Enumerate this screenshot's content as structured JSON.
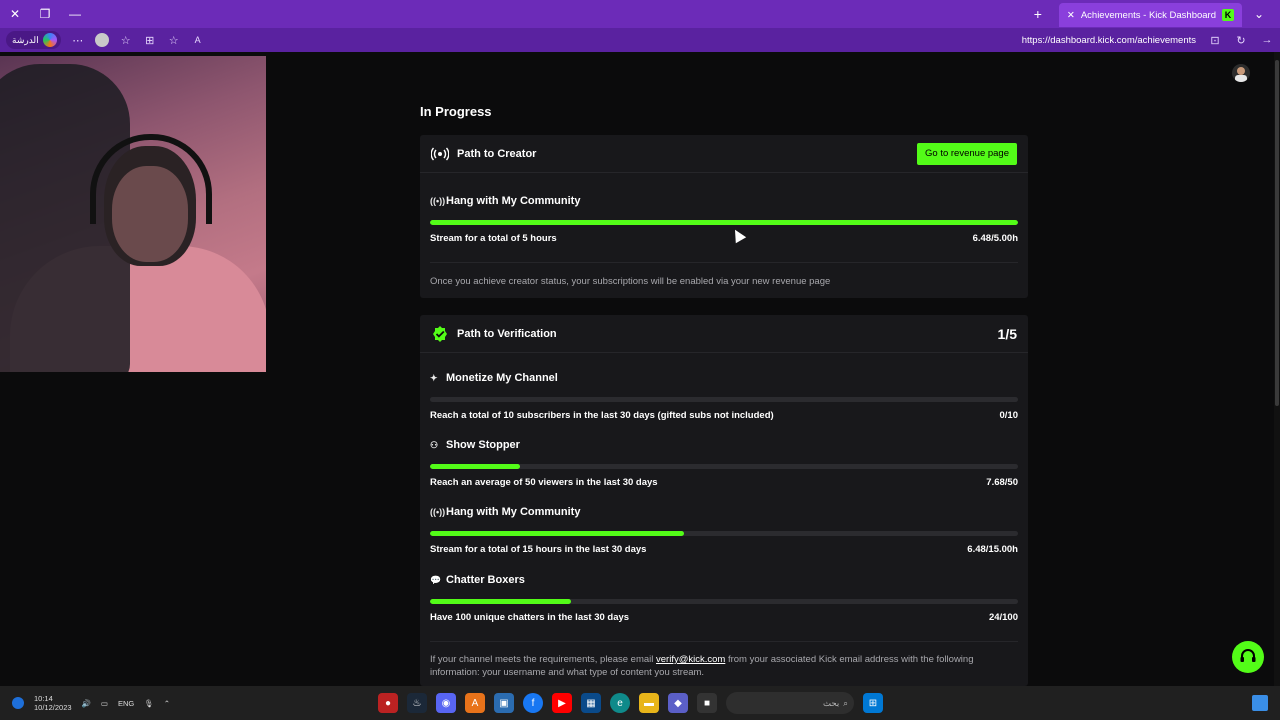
{
  "browser": {
    "tab_title": "Achievements - Kick Dashboard",
    "tab_favicon": "K",
    "url": "https://dashboard.kick.com/achievements",
    "profile_pill_text": "الدرشة"
  },
  "page": {
    "section_title": "In Progress",
    "creator_card": {
      "title": "Path to Creator",
      "button_label": "Go to revenue page",
      "achievement": {
        "title": "Hang with My Community",
        "description": "Stream for a total of 5 hours",
        "progress_text": "6.48/5.00h",
        "progress": 1.0
      },
      "note": "Once you achieve creator status, your subscriptions will be enabled via your new revenue page"
    },
    "verification_card": {
      "title": "Path to Verification",
      "counter": "1/5",
      "achievements": [
        {
          "icon": "sparkle-icon",
          "title": "Monetize My Channel",
          "description": "Reach a total of 10 subscribers in the last 30 days (gifted subs not included)",
          "progress_text": "0/10",
          "progress": 0.0
        },
        {
          "icon": "viewers-icon",
          "title": "Show Stopper",
          "description": "Reach an average of 50 viewers in the last 30 days",
          "progress_text": "7.68/50",
          "progress": 0.1536
        },
        {
          "icon": "broadcast-icon",
          "title": "Hang with My Community",
          "description": "Stream for a total of 15 hours in the last 30 days",
          "progress_text": "6.48/15.00h",
          "progress": 0.432
        },
        {
          "icon": "chat-icon",
          "title": "Chatter Boxers",
          "description": "Have 100 unique chatters in the last 30 days",
          "progress_text": "24/100",
          "progress": 0.24
        }
      ],
      "footer_before": "If your channel meets the requirements, please email ",
      "footer_link": "verify@kick.com",
      "footer_after": " from your associated Kick email address with the following information: your username and what type of content you stream."
    }
  },
  "taskbar": {
    "time": "10:14",
    "date": "10/12/2023",
    "lang": "ENG",
    "search_placeholder": "بحث"
  },
  "colors": {
    "accent": "#53fc18",
    "titlebar": "#6c2bb8",
    "card_bg": "#18181b",
    "page_bg": "#0b0b0c"
  }
}
